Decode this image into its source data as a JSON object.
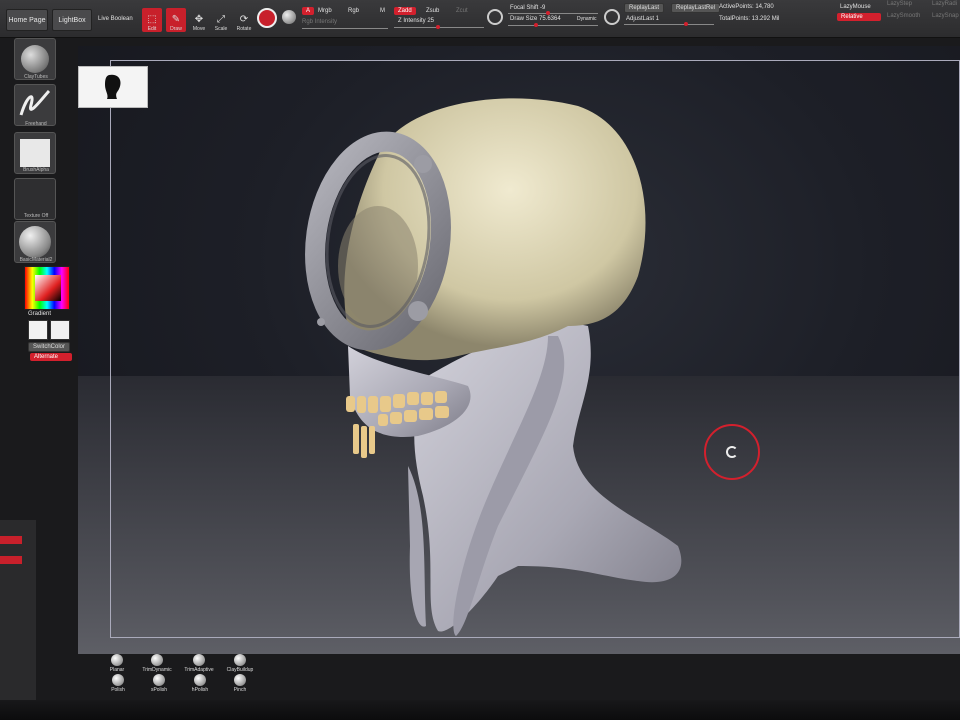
{
  "topbar": {
    "home_page": "Home Page",
    "lightbox": "LightBox",
    "live_boolean": "Live Boolean",
    "tools": [
      {
        "label": "Edit",
        "glyph": "⬚",
        "active": true
      },
      {
        "label": "Draw",
        "glyph": "✎",
        "active": true
      },
      {
        "label": "Move",
        "glyph": "✥",
        "active": false
      },
      {
        "label": "Scale",
        "glyph": "⤢",
        "active": false
      },
      {
        "label": "Rotate",
        "glyph": "⟳",
        "active": false
      }
    ],
    "a_label": "A",
    "mrgb": "Mrgb",
    "rgb": "Rgb",
    "m": "M",
    "rgb_intensity": "Rgb Intensity",
    "zadd": "Zadd",
    "zsub": "Zsub",
    "zcut": "Zcut",
    "z_intensity": "Z Intensity 25",
    "focal_shift": "Focal Shift -9",
    "draw_size": "Draw Size 75.6364",
    "dynamic": "Dynamic",
    "replay_last": "ReplayLast",
    "replay_last_rel": "ReplayLastRel",
    "adjust_last": "AdjustLast 1",
    "active_points": "ActivePoints: 14,780",
    "total_points": "TotalPoints: 13.292 Mil",
    "lazy_mouse": "LazyMouse",
    "relative": "Relative",
    "lazy_step": "LazyStep",
    "lazy_smooth": "LazySmooth",
    "lazy_radius": "LazyRadi",
    "lazy_snap": "LazySnap"
  },
  "leftshelf": {
    "claytubes": "ClayTubes",
    "freehand": "Freehand",
    "brush_alpha": "BrushAlpha",
    "texture_off": "Texture Off",
    "basic_material": "BasicMaterial2",
    "gradient": "Gradient",
    "switch_color": "SwitchColor",
    "alternate": "Alternate"
  },
  "brushes": [
    {
      "label": "Planar"
    },
    {
      "label": "TrimDynamic"
    },
    {
      "label": "TrimAdaptive"
    },
    {
      "label": "ClayBuildup"
    },
    {
      "label": "Polish"
    },
    {
      "label": "sPolish"
    },
    {
      "label": "hPolish"
    },
    {
      "label": "Pinch"
    }
  ],
  "colors": {
    "accent": "#d3202d",
    "bone": "#e6e0c4",
    "flesh": "#b9b8c3",
    "teeth": "#e8c98a"
  }
}
